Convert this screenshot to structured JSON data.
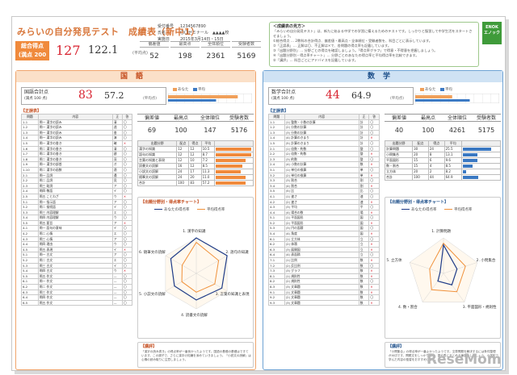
{
  "header": {
    "title": "みらいの自分発見テスト　成績表（新中1）",
    "total_label": "総合得点\n(満点 200 点)",
    "total_score": "127",
    "total_avg": "122.1",
    "avg_label": "(平均点)",
    "info": [
      {
        "k": "受付番号",
        "v": "1234567890"
      },
      {
        "k": "氏名",
        "v": "〇〇ゼミナール　▲▲▲▲校"
      },
      {
        "k": "実施日",
        "v": "2015年3月14日・15日"
      }
    ],
    "stats": [
      {
        "h": "偏差値",
        "v": "52"
      },
      {
        "h": "最高点",
        "v": "198"
      },
      {
        "h": "全体順位",
        "v": "2361"
      },
      {
        "h": "受験者数",
        "v": "5169"
      }
    ]
  },
  "advice": {
    "title": "＜成績表の見方＞",
    "lines": [
      "「みらいの自分発見テスト」は、新たに始まる中学での学習に備えるためのテストです。しっかりと復習して中学生活をスタートさせましょう。",
      "①総合得点 … 2教科の合計得点、偏差値・最高点・全体順位・受験者数を、科目ごとに表示しています。",
      "②「正誤表」… 正解は〇、不正解は✕で、各問題の得点率も記載しています。",
      "③「出題分野別」… 分野ごとの得点を確認しましょう。「得点率グラフ」で得意・不得意を把握しましょう。",
      "④「出題分野別・得点率チャート」… 分野ごとのあなたの得点率と平均得点率を比較できます。",
      "⑤「講評」… 科目ごとにアドバイスを記載しています。"
    ],
    "logo": "ENOK\nエノック"
  },
  "japanese": {
    "band": "国語",
    "score_label": "国語合計点",
    "score_sub": "(満点 100 点)",
    "score": "83",
    "avg": "57.2",
    "avg_label": "(平均点)",
    "legend": [
      "あなた",
      "平均"
    ],
    "bar_self": 0.83,
    "bar_avg": 0.572,
    "seigo_label": "【正誤表】",
    "table_head": [
      "問題",
      "内容",
      "正",
      "答"
    ],
    "rows": [
      [
        "1-1",
        "問一 漢字の読み",
        "清",
        "〇"
      ],
      [
        "1-2",
        "問一 漢字の読み",
        "週",
        "〇"
      ],
      [
        "1-3",
        "問一 漢字の読み",
        "書",
        "〇"
      ],
      [
        "1-4",
        "問一 漢字の読み",
        "演",
        "〇"
      ],
      [
        "1-5",
        "問一 漢字の書き",
        "確",
        "✕"
      ],
      [
        "1-6",
        "問二 漢字の書き",
        "清",
        "〇"
      ],
      [
        "1-7",
        "問二 漢字の書き",
        "建",
        "〇"
      ],
      [
        "1-8",
        "問二 漢字の書き",
        "深",
        "〇"
      ],
      [
        "1-9",
        "問一 漢字の部首",
        "才",
        "〇"
      ],
      [
        "1-10",
        "問二 漢字の画数",
        "適",
        "〇"
      ],
      [
        "2-1",
        "問一 品詞",
        "遇",
        "〇"
      ],
      [
        "2-2",
        "問二 品詞",
        "見",
        "〇"
      ],
      [
        "2-3",
        "問三 助詞",
        "ア",
        "〇"
      ],
      [
        "2-4",
        "問四 敬語",
        "イ",
        "〇"
      ],
      [
        "2-5",
        "問五 ことわざ",
        "ウ",
        "✕"
      ],
      [
        "3-1",
        "問一 指示語",
        "ア",
        "〇"
      ],
      [
        "3-2",
        "問二 接続語",
        "イ",
        "〇"
      ],
      [
        "3-3",
        "問三 内容理解",
        "エ",
        "〇"
      ],
      [
        "3-4",
        "問四 内容理解",
        "ウ",
        "〇"
      ],
      [
        "3-5",
        "問五 要旨",
        "ア",
        "✕"
      ],
      [
        "4-1",
        "問一 語句の意味",
        "イ",
        "〇"
      ],
      [
        "4-2",
        "問二 心情",
        "エ",
        "〇"
      ],
      [
        "4-3",
        "問三 心情",
        "ア",
        "〇"
      ],
      [
        "4-4",
        "問四 理由",
        "ウ",
        "〇"
      ],
      [
        "4-5",
        "問五 表現",
        "イ",
        "✕"
      ],
      [
        "5-1",
        "問一 古文",
        "ア",
        "〇"
      ],
      [
        "5-2",
        "問二 古文",
        "エ",
        "〇"
      ],
      [
        "5-3",
        "問三 古文",
        "イ",
        "〇"
      ],
      [
        "5-4",
        "問四 古文",
        "ウ",
        "✕"
      ],
      [
        "5-5",
        "問五 作文",
        "—",
        "〇"
      ],
      [
        "6-1",
        "問一 作文",
        "—",
        "〇"
      ],
      [
        "6-2",
        "問二 作文",
        "—",
        "〇"
      ],
      [
        "6-3",
        "問三 作文",
        "—",
        "〇"
      ],
      [
        "6-4",
        "問四 作文",
        "—",
        "〇"
      ],
      [
        "6-5",
        "問五 作文",
        "—",
        "〇"
      ]
    ],
    "stats": [
      {
        "h": "偏差値",
        "v": "69"
      },
      {
        "h": "最高点",
        "v": "100"
      },
      {
        "h": "全体順位",
        "v": "147"
      },
      {
        "h": "受験者数",
        "v": "5176"
      }
    ],
    "field_head": [
      "出題分野",
      "配点",
      "得点",
      "平均"
    ],
    "fields": [
      {
        "name": "漢字の知識",
        "max": "12",
        "pt": "12",
        "avg": "10.5",
        "rate": 1.0
      },
      {
        "name": "語句の知識",
        "max": "12",
        "pt": "12",
        "avg": "8.7",
        "rate": 1.0
      },
      {
        "name": "言葉の知識と表現",
        "max": "12",
        "pt": "10",
        "avg": "7.2",
        "rate": 0.83
      },
      {
        "name": "読書文の読解",
        "max": "16",
        "pt": "12",
        "avg": "8.5",
        "rate": 0.75
      },
      {
        "name": "小説文の読解",
        "max": "24",
        "pt": "17",
        "avg": "11.3",
        "rate": 0.71
      },
      {
        "name": "随筆文の読解",
        "max": "24",
        "pt": "20",
        "avg": "11.0",
        "rate": 0.83
      },
      {
        "name": "合計",
        "max": "100",
        "pt": "83",
        "avg": "57.2",
        "rate": 0.83
      }
    ],
    "chart_title": "【出題分野別・得点率チャート】",
    "chart_legend": [
      "あなたの得点率",
      "平均得点率"
    ],
    "radar_labels": [
      "1. 漢字の知識",
      "2. 語句の知識",
      "3. 言葉の知識と表現",
      "4. 読書文の読解",
      "5. 小説文の読解",
      "6. 随筆文の読解"
    ],
    "radar_self": [
      1.0,
      1.0,
      0.83,
      0.75,
      0.71,
      0.83
    ],
    "radar_avg": [
      0.875,
      0.725,
      0.6,
      0.53,
      0.47,
      0.46
    ],
    "review_label": "【講評】",
    "review_text": "「漢字の読み書き」の得点率が一番良かったようです。国語の基礎の基礎はできています。この調子で、さらに漢字の知識を深めていきましょう。「小説文の読解」は心情の読み取りに注意しましょう。"
  },
  "math": {
    "band": "数学",
    "score_label": "数学合計点",
    "score_sub": "(満点 100 点)",
    "score": "44",
    "avg": "64.9",
    "avg_label": "(平均点)",
    "legend": [
      "あなた",
      "平均"
    ],
    "bar_self": 0.44,
    "bar_avg": 0.649,
    "seigo_label": "【正誤表】",
    "table_head": [
      "問題",
      "内容",
      "正",
      "答"
    ],
    "rows": [
      [
        "1-1",
        "(1) 整数・小数の計算",
        "計",
        "〇"
      ],
      [
        "1-2",
        "(2) 分数の計算",
        "計",
        "〇"
      ],
      [
        "1-3",
        "(3) 分数の計算",
        "計",
        "〇"
      ],
      [
        "1-4",
        "(4) 計算のきまり",
        "計",
        "✕"
      ],
      [
        "1-5",
        "(5) 計算のきまり",
        "計",
        "〇"
      ],
      [
        "2-1",
        "(1) 倍数・約数",
        "整",
        "〇"
      ],
      [
        "2-2",
        "(2) 倍数・約数",
        "整",
        "✕"
      ],
      [
        "2-3",
        "(3) 約数",
        "整",
        "〇"
      ],
      [
        "2-4",
        "(4) 小数の計算",
        "数",
        "✕"
      ],
      [
        "3-1",
        "(1) 単位の換算",
        "単",
        "〇"
      ],
      [
        "3-2",
        "(2) 単位の換算",
        "単",
        "✕"
      ],
      [
        "3-3",
        "(3) 割合",
        "割",
        "〇"
      ],
      [
        "3-4",
        "(4) 割合",
        "割",
        "✕"
      ],
      [
        "3-5",
        "(5) 比",
        "比",
        "〇"
      ],
      [
        "4-1",
        "(1) 速さ",
        "速",
        "〇"
      ],
      [
        "4-2",
        "(2) 速さ",
        "速",
        "✕"
      ],
      [
        "4-3",
        "(3) 平均",
        "平",
        "〇"
      ],
      [
        "4-4",
        "(4) 場合の数",
        "場",
        "✕"
      ],
      [
        "5-1",
        "(1) 平面図形",
        "図",
        "〇"
      ],
      [
        "5-2",
        "(2) 平面図形",
        "図",
        "✕"
      ],
      [
        "5-3",
        "(3) 円の面積",
        "図",
        "〇"
      ],
      [
        "5-4",
        "(4) 角度",
        "図",
        "✕"
      ],
      [
        "6-1",
        "(1) 立方体",
        "立",
        "〇"
      ],
      [
        "6-2",
        "(2) 体積",
        "立",
        "✕"
      ],
      [
        "6-3",
        "(3) 展開図",
        "立",
        "✕"
      ],
      [
        "6-4",
        "(4) 表面積",
        "立",
        "〇"
      ],
      [
        "7-1",
        "(1) 比例",
        "数",
        "✕"
      ],
      [
        "7-2",
        "(2) 反比例",
        "数",
        "〇"
      ],
      [
        "7-3",
        "(3) グラフ",
        "数",
        "✕"
      ],
      [
        "8-1",
        "(1) 規則性",
        "数",
        "✕"
      ],
      [
        "8-2",
        "(2) 規則性",
        "数",
        "〇"
      ],
      [
        "8-3",
        "(3) 文章題",
        "数",
        "✕"
      ],
      [
        "9-1",
        "(1) 文章題",
        "数",
        "✕"
      ],
      [
        "9-2",
        "(2) 文章題",
        "数",
        "〇"
      ],
      [
        "9-3",
        "(3) 文章題",
        "数",
        "✕"
      ]
    ],
    "stats": [
      {
        "h": "偏差値",
        "v": "40"
      },
      {
        "h": "最高点",
        "v": "100"
      },
      {
        "h": "全体順位",
        "v": "4261"
      },
      {
        "h": "受験者数",
        "v": "5175"
      }
    ],
    "field_head": [
      "出題分野",
      "配点",
      "得点",
      "平均"
    ],
    "fields": [
      {
        "name": "計算問題",
        "max": "30",
        "pt": "24",
        "avg": "25.5",
        "rate": 0.8
      },
      {
        "name": "小問集合",
        "max": "20",
        "pt": "8",
        "avg": "13.1",
        "rate": 0.4
      },
      {
        "name": "平面図形",
        "max": "15",
        "pt": "6",
        "avg": "9.6",
        "rate": 0.4
      },
      {
        "name": "数・割合",
        "max": "15",
        "pt": "4",
        "avg": "8.5",
        "rate": 0.27
      },
      {
        "name": "立方体",
        "max": "20",
        "pt": "2",
        "avg": "8.2",
        "rate": 0.1
      },
      {
        "name": "合計",
        "max": "100",
        "pt": "44",
        "avg": "64.9",
        "rate": 0.44
      }
    ],
    "chart_title": "【出題分野別・得点率チャート】",
    "chart_legend": [
      "あなたの得点率",
      "平均得点率"
    ],
    "radar_labels": [
      "1. 計算問題",
      "2. 小問集合",
      "3. 平面図形・規則性",
      "4. 数・割合",
      "5. 立方体"
    ],
    "radar_self": [
      0.8,
      0.4,
      0.4,
      0.27,
      0.1
    ],
    "radar_avg": [
      0.85,
      0.65,
      0.64,
      0.57,
      0.41
    ],
    "review_label": "【講評】",
    "review_text": "「小問集合」の得点率が一番よかったようです。文章問題を解決するには条件整理が大切です。問題文をしっかり読み、図や表にまとめる練習をしましょう。小学校で学んだ内容の復習をおすすめします。"
  },
  "watermark": "ReseMom",
  "colors": {
    "jp_accent": "#f08a3c",
    "ma_accent": "#3a78c2",
    "self_line": "#1f3c88",
    "avg_line": "#f0913a"
  }
}
